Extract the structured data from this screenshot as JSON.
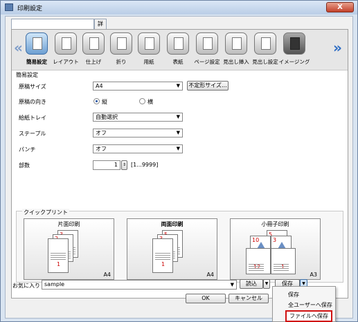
{
  "window": {
    "title": "印刷設定",
    "close": "X"
  },
  "tabs": [
    "",
    "詳細設定"
  ],
  "ribbon": {
    "items": [
      "簡易設定",
      "レイアウト",
      "仕上げ",
      "折り",
      "用紙",
      "表紙",
      "ページ設定",
      "見出し挿入",
      "見出し設定",
      "イメージング"
    ]
  },
  "simple": {
    "group_label": "簡易設定",
    "original_size_label": "原稿サイズ",
    "original_size_value": "A4",
    "custom_size_button": "不定形サイズ...",
    "orientation_label": "原稿の向き",
    "portrait": "縦",
    "landscape": "横",
    "tray_label": "給紙トレイ",
    "tray_value": "自動選択",
    "staple_label": "ステープル",
    "staple_value": "オフ",
    "punch_label": "パンチ",
    "punch_value": "オフ",
    "copies_label": "部数",
    "copies_value": "1",
    "copies_range": "[1...9999]"
  },
  "quickprint": {
    "label": "クイックプリント",
    "cards": [
      {
        "title": "片面印刷",
        "size": "A4"
      },
      {
        "title": "両面印刷",
        "size": "A4"
      },
      {
        "title": "小冊子印刷",
        "size": "A3"
      }
    ]
  },
  "favorites": {
    "label": "お気に入り",
    "value": "sample",
    "load_button": "読込",
    "save_button": "保存"
  },
  "footer": {
    "ok": "OK",
    "cancel": "キャンセル"
  },
  "save_menu": {
    "items": [
      "保存",
      "全ユーザーへ保存",
      "ファイルへ保存"
    ]
  }
}
